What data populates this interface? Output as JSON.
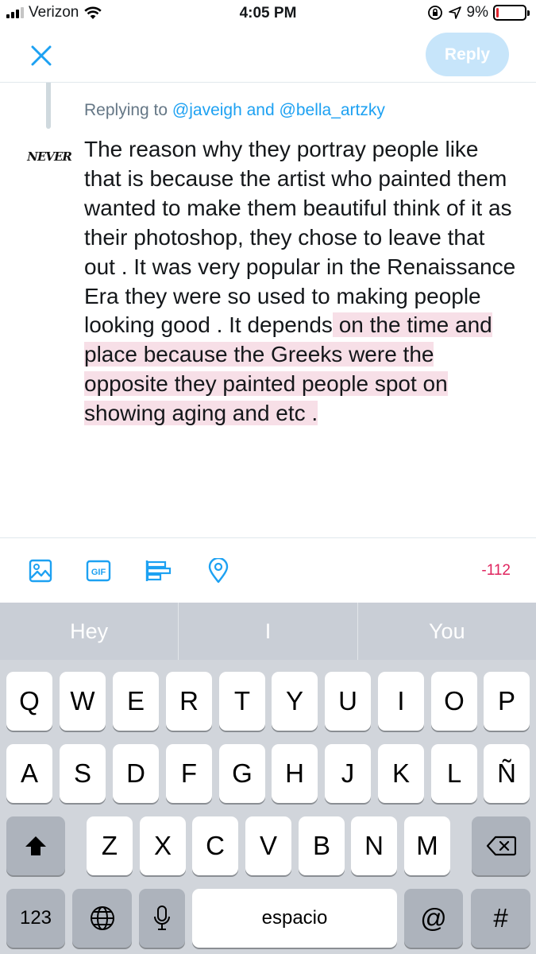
{
  "status_bar": {
    "carrier": "Verizon",
    "time": "4:05 PM",
    "battery_percent": "9%",
    "battery_level": 0.09
  },
  "header": {
    "close_icon": "close-icon",
    "reply_label": "Reply"
  },
  "compose": {
    "replying_prefix": "Replying to",
    "mention_1": "@javeigh",
    "replying_and": "and",
    "mention_2": "@bella_artzky",
    "avatar_text": "NEVER",
    "text_within": "The reason why they portray people like that is because the artist who painted them wanted to make them beautiful think of it as their photoshop, they chose to leave that out . It was very popular in the Renaissance Era they were so used to making people looking good . It depends",
    "text_over": " on the time and place because the Greeks were the opposite they painted people spot on showing aging and etc . "
  },
  "toolbar": {
    "icons": [
      "image-icon",
      "gif-icon",
      "poll-icon",
      "location-icon"
    ],
    "gif_label": "GIF",
    "char_count": "-112"
  },
  "keyboard": {
    "suggestions": [
      "Hey",
      "I",
      "You"
    ],
    "row1": [
      "Q",
      "W",
      "E",
      "R",
      "T",
      "Y",
      "U",
      "I",
      "O",
      "P"
    ],
    "row2": [
      "A",
      "S",
      "D",
      "F",
      "G",
      "H",
      "J",
      "K",
      "L",
      "Ñ"
    ],
    "row3": [
      "Z",
      "X",
      "C",
      "V",
      "B",
      "N",
      "M"
    ],
    "numbers_label": "123",
    "space_label": "espacio",
    "at_label": "@",
    "hash_label": "#"
  }
}
